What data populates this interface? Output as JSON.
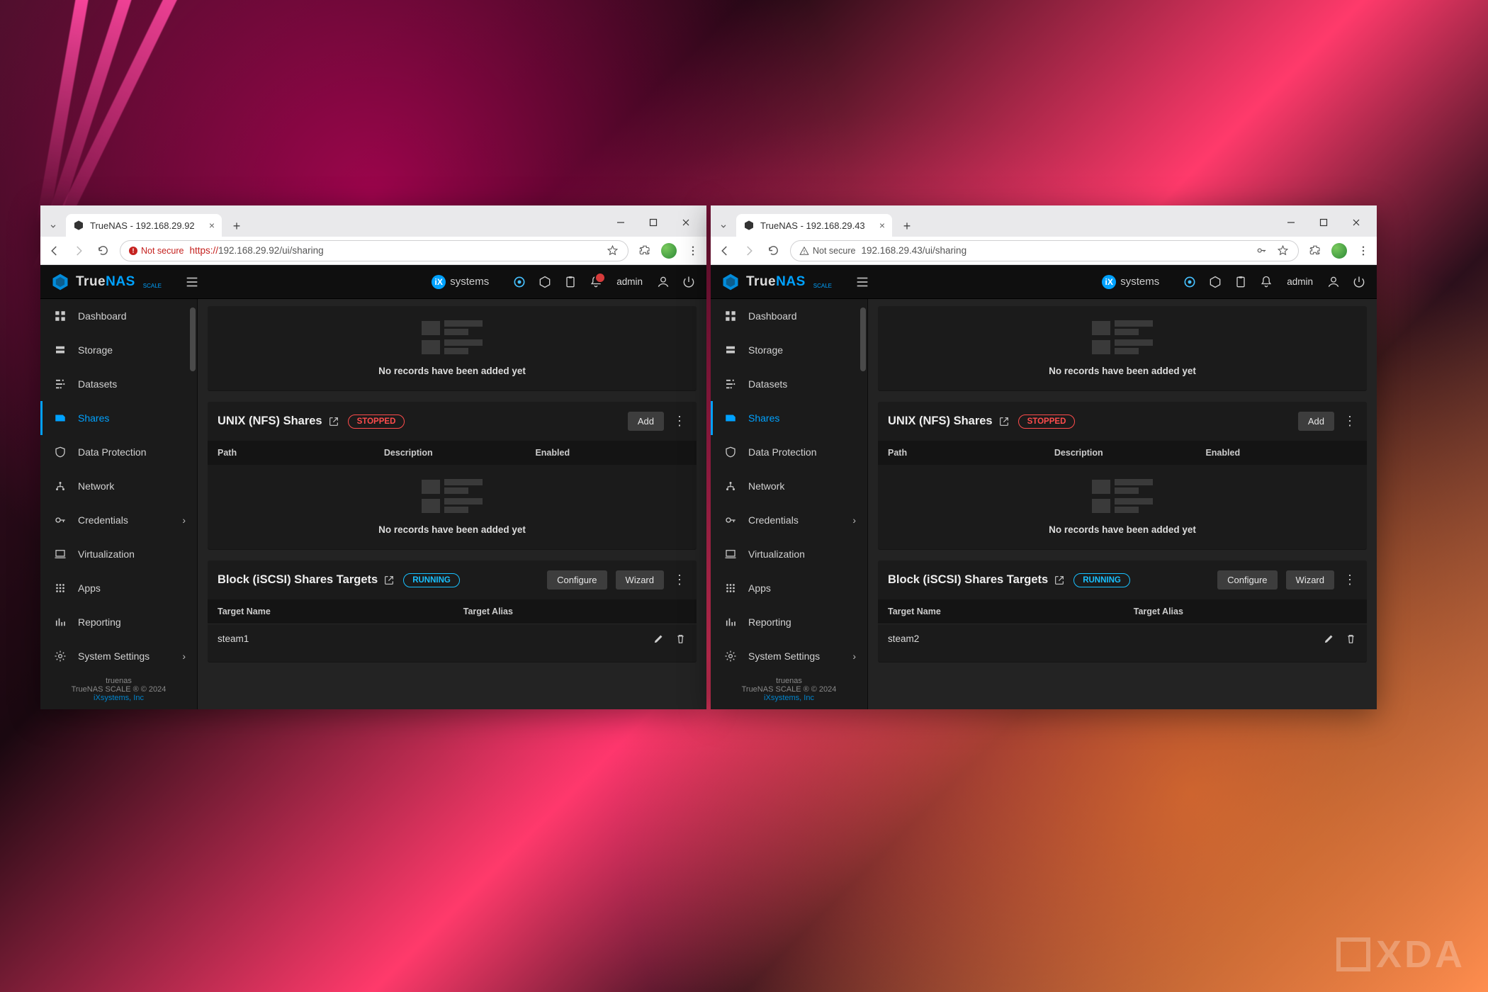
{
  "watermark": "XDA",
  "windows": [
    {
      "tab_title": "TrueNAS - 192.168.29.92",
      "security_label": "Not secure",
      "security_kind": "danger",
      "url_scheme": "https://",
      "url_rest": "192.168.29.92/ui/sharing",
      "header_bell_badge": true,
      "iscsi_target": "steam1",
      "footer_host": "truenas",
      "addr_key_icon": false
    },
    {
      "tab_title": "TrueNAS - 192.168.29.43",
      "security_label": "Not secure",
      "security_kind": "warn",
      "url_scheme": "",
      "url_rest": "192.168.29.43/ui/sharing",
      "header_bell_badge": false,
      "iscsi_target": "steam2",
      "footer_host": "truenas",
      "addr_key_icon": true
    }
  ],
  "brand": {
    "a": "True",
    "b": "NAS",
    "sub": "SCALE"
  },
  "ix_label": "systems",
  "admin_label": "admin",
  "sidebar": {
    "items": [
      {
        "label": "Dashboard"
      },
      {
        "label": "Storage"
      },
      {
        "label": "Datasets"
      },
      {
        "label": "Shares"
      },
      {
        "label": "Data Protection"
      },
      {
        "label": "Network"
      },
      {
        "label": "Credentials",
        "expandable": true
      },
      {
        "label": "Virtualization"
      },
      {
        "label": "Apps"
      },
      {
        "label": "Reporting"
      },
      {
        "label": "System Settings",
        "expandable": true
      }
    ],
    "footer_line": "TrueNAS SCALE ® © 2024",
    "footer_link": "iXsystems, Inc"
  },
  "cards": {
    "empty_msg": "No records have been added yet",
    "nfs": {
      "title": "UNIX (NFS) Shares",
      "status": "STOPPED",
      "add": "Add",
      "cols": [
        "Path",
        "Description",
        "Enabled"
      ]
    },
    "iscsi": {
      "title": "Block (iSCSI) Shares Targets",
      "status": "RUNNING",
      "configure": "Configure",
      "wizard": "Wizard",
      "cols": [
        "Target Name",
        "Target Alias"
      ]
    }
  }
}
